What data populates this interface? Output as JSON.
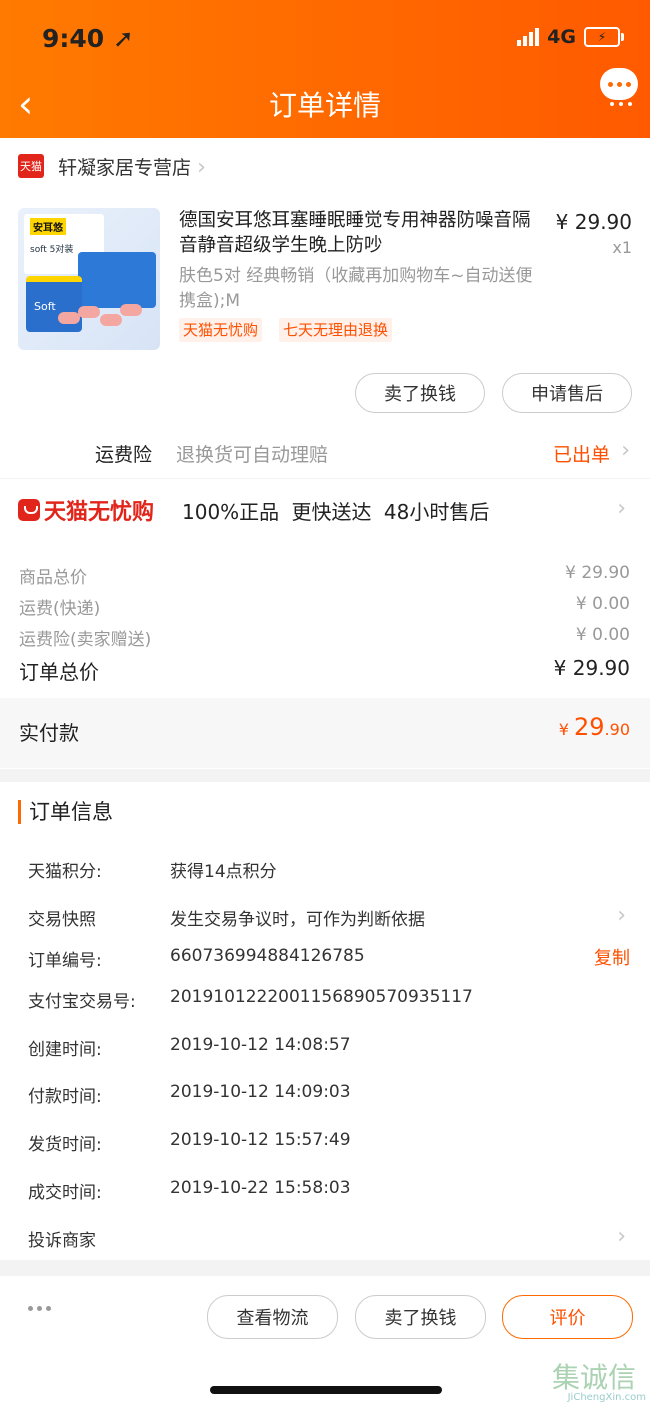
{
  "status_bar": {
    "time": "9:40",
    "network": "4G"
  },
  "header": {
    "title": "订单详情"
  },
  "store": {
    "badge": "天猫",
    "name": "轩凝家居专营店"
  },
  "product": {
    "image_labels": {
      "brand": "安耳悠",
      "pack": "soft 5对装",
      "soft": "Soft"
    },
    "title": "德国安耳悠耳塞睡眠睡觉专用神器防噪音隔音静音超级学生晚上防吵",
    "price": "¥ 29.90",
    "qty": "x1",
    "sku": "肤色5对 经典畅销（收藏再加购物车~自动送便携盒);M",
    "tags": [
      "天猫无忧购",
      "七天无理由退换"
    ],
    "actions": [
      "卖了换钱",
      "申请售后"
    ]
  },
  "insurance": {
    "label": "运费险",
    "desc": "退换货可自动理赔",
    "status": "已出单"
  },
  "wuyou": {
    "brand": "天猫无忧购",
    "features": "100%正品  更快送达  48小时售后"
  },
  "fees": [
    {
      "label": "商品总价",
      "value": "¥ 29.90"
    },
    {
      "label": "运费(快递)",
      "value": "¥ 0.00"
    },
    {
      "label": "运费险(卖家赠送)",
      "value": "¥ 0.00"
    }
  ],
  "order_total": {
    "label": "订单总价",
    "value": "¥ 29.90"
  },
  "paid": {
    "label": "实付款",
    "currency": "¥ ",
    "int": "29",
    "dec": ".90"
  },
  "order_info": {
    "title": "订单信息",
    "rows": [
      {
        "label": "天猫积分:",
        "value": "获得14点积分"
      },
      {
        "label": "交易快照",
        "value": "发生交易争议时，可作为判断依据"
      },
      {
        "label": "订单编号:",
        "value": "660736994884126785"
      },
      {
        "label": "支付宝交易号:",
        "value": "2019101222001156890570935117"
      },
      {
        "label": "创建时间:",
        "value": "2019-10-12 14:08:57"
      },
      {
        "label": "付款时间:",
        "value": "2019-10-12 14:09:03"
      },
      {
        "label": "发货时间:",
        "value": "2019-10-12 15:57:49"
      },
      {
        "label": "成交时间:",
        "value": "2019-10-22 15:58:03"
      }
    ],
    "copy_label": "复制",
    "complaint": "投诉商家"
  },
  "bottom_actions": [
    "查看物流",
    "卖了换钱",
    "评价"
  ],
  "watermark": {
    "chars": "集诚信",
    "url": "JiChengXin.com"
  },
  "colors": {
    "accent": "#ff5000",
    "header_start": "#ff7a00",
    "header_end": "#ff5a00"
  }
}
